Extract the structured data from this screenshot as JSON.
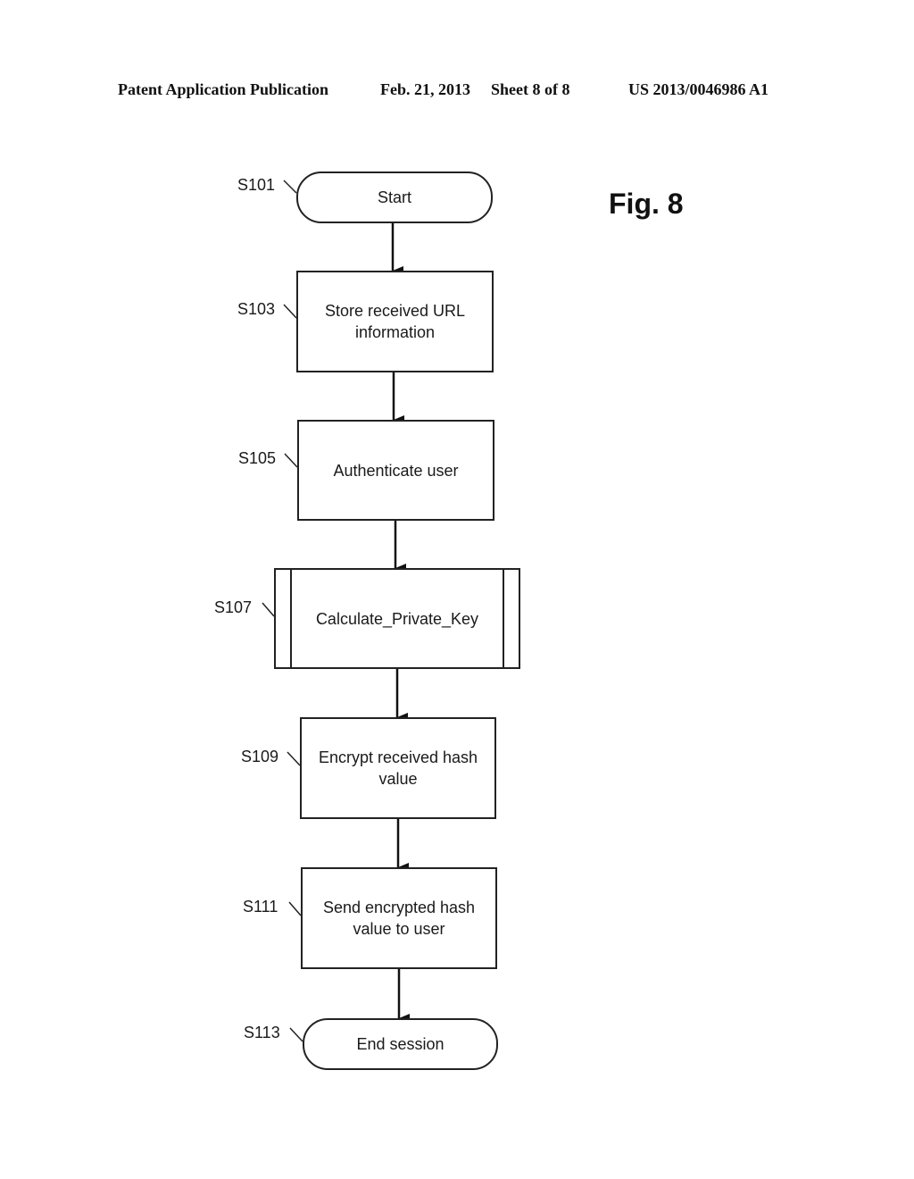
{
  "header": {
    "publication": "Patent Application Publication",
    "date": "Feb. 21, 2013",
    "sheet": "Sheet 8 of 8",
    "number": "US 2013/0046986 A1"
  },
  "figure_label": "Fig. 8",
  "flowchart": {
    "steps": [
      {
        "id": "S101",
        "label": "S101",
        "text": "Start",
        "shape": "terminal"
      },
      {
        "id": "S103",
        "label": "S103",
        "text": "Store received URL information",
        "shape": "process"
      },
      {
        "id": "S105",
        "label": "S105",
        "text": "Authenticate user",
        "shape": "process"
      },
      {
        "id": "S107",
        "label": "S107",
        "text": "Calculate_Private_Key",
        "shape": "predefined-process"
      },
      {
        "id": "S109",
        "label": "S109",
        "text": "Encrypt received hash value",
        "shape": "process"
      },
      {
        "id": "S111",
        "label": "S111",
        "text": "Send encrypted hash value to user",
        "shape": "process"
      },
      {
        "id": "S113",
        "label": "S113",
        "text": "End session",
        "shape": "terminal"
      }
    ],
    "edges": [
      [
        "S101",
        "S103"
      ],
      [
        "S103",
        "S105"
      ],
      [
        "S105",
        "S107"
      ],
      [
        "S107",
        "S109"
      ],
      [
        "S109",
        "S111"
      ],
      [
        "S111",
        "S113"
      ]
    ]
  }
}
